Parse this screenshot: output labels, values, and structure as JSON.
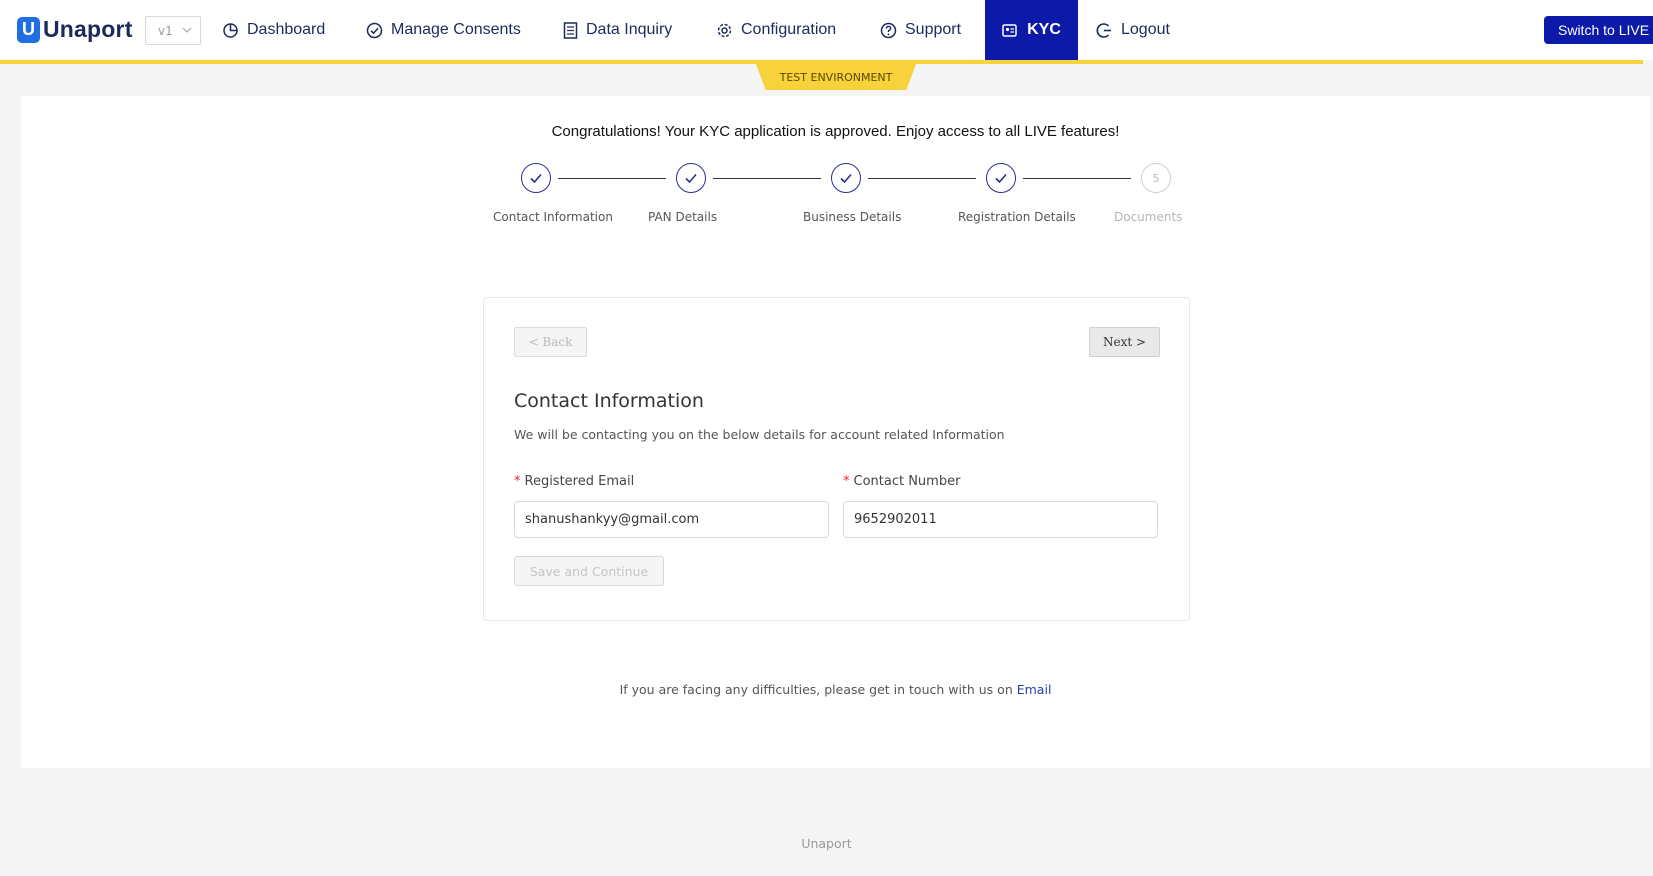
{
  "brand": {
    "logo_letter": "U",
    "name": "Unaport"
  },
  "version_select": {
    "value": "v1"
  },
  "nav": {
    "dashboard": "Dashboard",
    "manage_consents": "Manage Consents",
    "data_inquiry": "Data Inquiry",
    "configuration": "Configuration",
    "support": "Support",
    "kyc": "KYC",
    "logout": "Logout"
  },
  "switch_button": "Switch to LIVE",
  "environment_tag": "TEST ENVIRONMENT",
  "colors": {
    "primary": "#0d1aa8",
    "accent_yellow": "#f7d23a",
    "step_color": "#2b2f8f",
    "required": "#f5222d"
  },
  "kyc": {
    "banner": "Congratulations! Your KYC application is approved. Enjoy access to all LIVE features!",
    "steps": [
      {
        "label": "Contact Information",
        "status": "done"
      },
      {
        "label": "PAN Details",
        "status": "done"
      },
      {
        "label": "Business Details",
        "status": "done"
      },
      {
        "label": "Registration Details",
        "status": "done"
      },
      {
        "label": "Documents",
        "status": "pending",
        "number": "5"
      }
    ]
  },
  "form": {
    "back_label": "<  Back",
    "next_label": "Next  >",
    "title": "Contact Information",
    "description": "We will be contacting you on the below details for account related Information",
    "email_label": "Registered Email",
    "email_value": "shanushankyy@gmail.com",
    "phone_label": "Contact Number",
    "phone_value": "9652902011",
    "required_mark": "*",
    "save_label": "Save and Continue"
  },
  "help": {
    "text": "If you are facing any difficulties, please get in touch with us on",
    "link_label": "Email"
  },
  "footer": "Unaport"
}
